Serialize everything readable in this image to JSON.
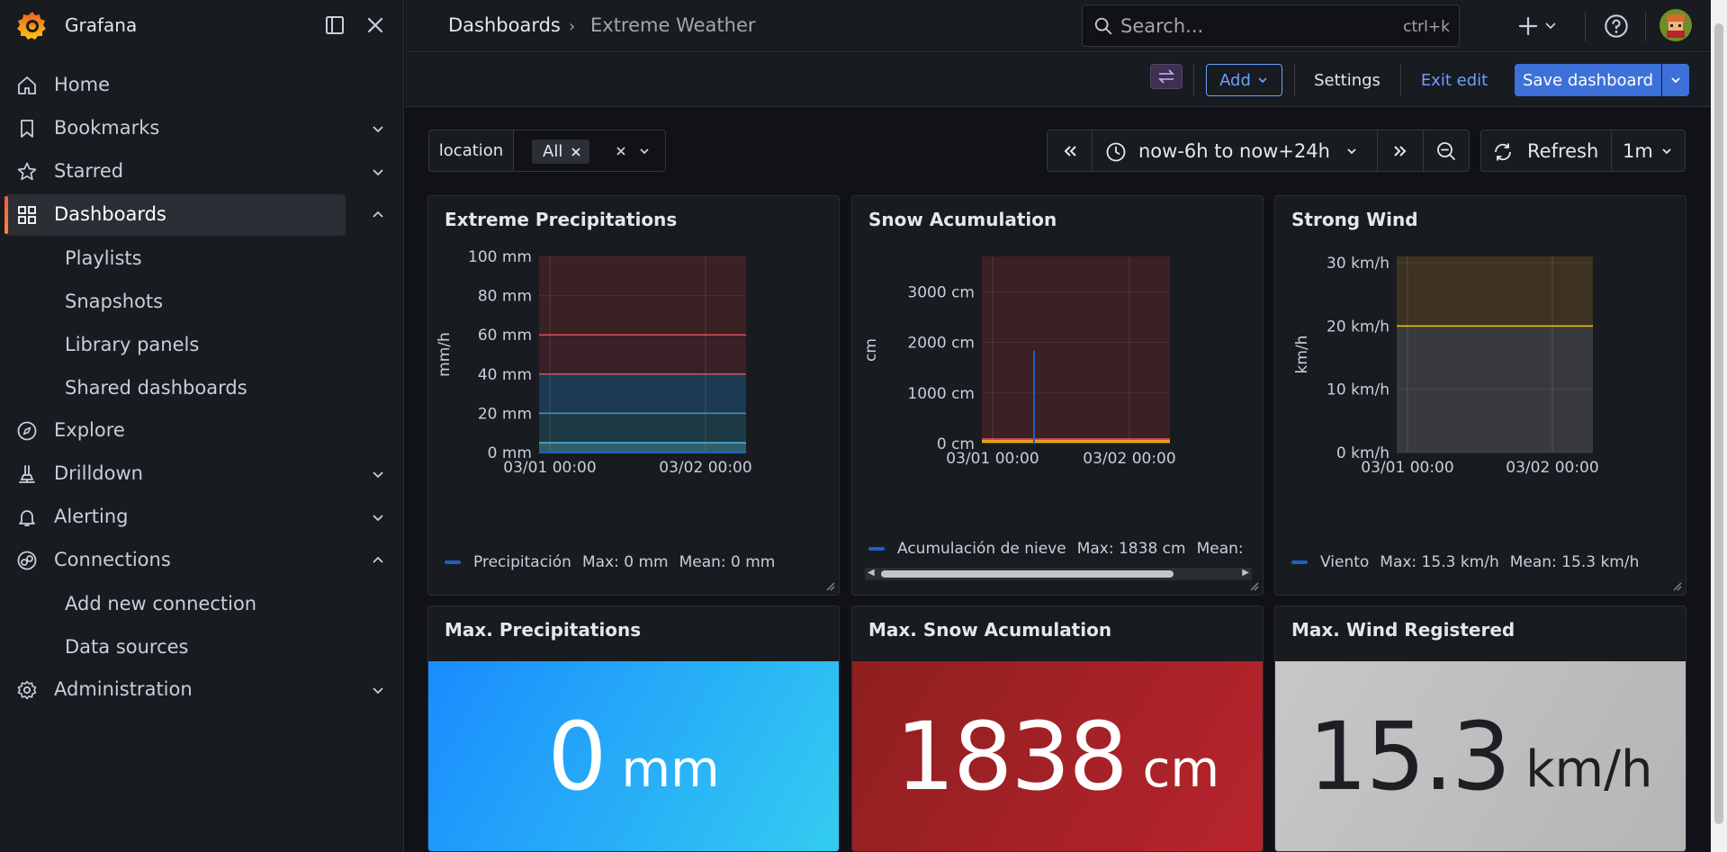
{
  "app": {
    "name": "Grafana"
  },
  "sidebar": {
    "items": [
      {
        "label": "Home",
        "icon": "home-icon",
        "expandable": false
      },
      {
        "label": "Bookmarks",
        "icon": "bookmark-icon",
        "expandable": true,
        "expanded": false
      },
      {
        "label": "Starred",
        "icon": "star-icon",
        "expandable": true,
        "expanded": false
      },
      {
        "label": "Dashboards",
        "icon": "apps-icon",
        "expandable": true,
        "expanded": true,
        "active": true
      },
      {
        "label": "Explore",
        "icon": "compass-icon",
        "expandable": false
      },
      {
        "label": "Drilldown",
        "icon": "drilldown-icon",
        "expandable": true,
        "expanded": false
      },
      {
        "label": "Alerting",
        "icon": "bell-icon",
        "expandable": true,
        "expanded": false
      },
      {
        "label": "Connections",
        "icon": "plug-icon",
        "expandable": true,
        "expanded": true
      },
      {
        "label": "Administration",
        "icon": "cog-icon",
        "expandable": true,
        "expanded": false
      }
    ],
    "dashboards_children": [
      "Playlists",
      "Snapshots",
      "Library panels",
      "Shared dashboards"
    ],
    "connections_children": [
      "Add new connection",
      "Data sources"
    ]
  },
  "topbar": {
    "breadcrumb": [
      "Dashboards",
      "Extreme Weather"
    ],
    "search_placeholder": "Search...",
    "search_shortcut": "ctrl+k"
  },
  "editbar": {
    "add_label": "Add",
    "settings_label": "Settings",
    "exit_label": "Exit edit",
    "save_label": "Save dashboard"
  },
  "variables": {
    "label": "location",
    "value": "All"
  },
  "time": {
    "range": "now-6h to now+24h",
    "refresh_label": "Refresh",
    "interval": "1m"
  },
  "panels": {
    "precip": {
      "title": "Extreme Precipitations",
      "ylabel": "mm/h",
      "legend_series": "Precipitación",
      "legend_max": "Max: 0 mm",
      "legend_mean": "Mean: 0 mm"
    },
    "snow": {
      "title": "Snow Acumulation",
      "ylabel": "cm",
      "legend_series": "Acumulación de nieve",
      "legend_max": "Max: 1838 cm",
      "legend_mean": "Mean:"
    },
    "wind": {
      "title": "Strong Wind",
      "ylabel": "km/h",
      "legend_series": "Viento",
      "legend_max": "Max: 15.3 km/h",
      "legend_mean": "Mean: 15.3 km/h"
    },
    "stat_precip": {
      "title": "Max. Precipitations",
      "value": "0",
      "unit": "mm",
      "color_start": "#1a8cff",
      "color_end": "#33ccf0"
    },
    "stat_snow": {
      "title": "Max. Snow Acumulation",
      "value": "1838",
      "unit": "cm",
      "color_start": "#8e1f1f",
      "color_end": "#b8242e"
    },
    "stat_wind": {
      "title": "Max. Wind Registered",
      "value": "15.3",
      "unit": "km/h",
      "color_start": "#c7c7c7",
      "color_end": "#b5b5b5"
    }
  },
  "chart_data": [
    {
      "id": "precip",
      "type": "line",
      "title": "Extreme Precipitations",
      "ylabel": "mm/h",
      "ylim": [
        0,
        100
      ],
      "yticks": [
        "0 mm",
        "20 mm",
        "40 mm",
        "60 mm",
        "80 mm",
        "100 mm"
      ],
      "ytick_values": [
        0,
        20,
        40,
        60,
        80,
        100
      ],
      "xticks": [
        "03/01 00:00",
        "03/02 00:00"
      ],
      "thresholds": [
        {
          "from": 0,
          "to": 5,
          "color": "#2f5f6a"
        },
        {
          "from": 5,
          "to": 20,
          "color": "#1d3a44"
        },
        {
          "from": 20,
          "to": 40,
          "color": "#1b3a52"
        },
        {
          "from": 40,
          "to": 60,
          "color": "#3a1f26"
        },
        {
          "from": 60,
          "to": 100,
          "color": "#3b2024"
        }
      ],
      "threshold_lines": [
        {
          "value": 5,
          "color": "#4fb6e8"
        },
        {
          "value": 20,
          "color": "#3d8fd6"
        },
        {
          "value": 40,
          "color": "#e04e5a"
        },
        {
          "value": 60,
          "color": "#e04e5a"
        }
      ],
      "series": [
        {
          "name": "Precipitación",
          "values": [
            0,
            0
          ],
          "color": "#1f60c4"
        }
      ]
    },
    {
      "id": "snow",
      "type": "line",
      "title": "Snow Acumulation",
      "ylabel": "cm",
      "ylim": [
        0,
        3700
      ],
      "yticks": [
        "0 cm",
        "1000 cm",
        "2000 cm",
        "3000 cm"
      ],
      "ytick_values": [
        0,
        1000,
        2000,
        3000
      ],
      "xticks": [
        "03/01 00:00",
        "03/02 00:00"
      ],
      "thresholds": [
        {
          "from": 0,
          "to": 3700,
          "color": "#3b2024"
        }
      ],
      "threshold_lines": [
        {
          "value": 30,
          "color": "#f2cc0c"
        },
        {
          "value": 60,
          "color": "#ff9830"
        },
        {
          "value": 90,
          "color": "#e04e5a"
        }
      ],
      "series": [
        {
          "name": "Acumulación de nieve",
          "values": [
            0,
            1838
          ],
          "color": "#1f60c4"
        }
      ]
    },
    {
      "id": "wind",
      "type": "line",
      "title": "Strong Wind",
      "ylabel": "km/h",
      "ylim": [
        0,
        31
      ],
      "yticks": [
        "0 km/h",
        "10 km/h",
        "20 km/h",
        "30 km/h"
      ],
      "ytick_values": [
        0,
        10,
        20,
        30
      ],
      "xticks": [
        "03/01 00:00",
        "03/02 00:00"
      ],
      "thresholds": [
        {
          "from": 0,
          "to": 20,
          "color": "#393a3e"
        },
        {
          "from": 20,
          "to": 31,
          "color": "#3d3222"
        }
      ],
      "threshold_lines": [
        {
          "value": 20,
          "color": "#f2cc0c"
        }
      ],
      "series": [
        {
          "name": "Viento",
          "values": [
            15.3
          ],
          "color": "#1f60c4"
        }
      ]
    }
  ]
}
